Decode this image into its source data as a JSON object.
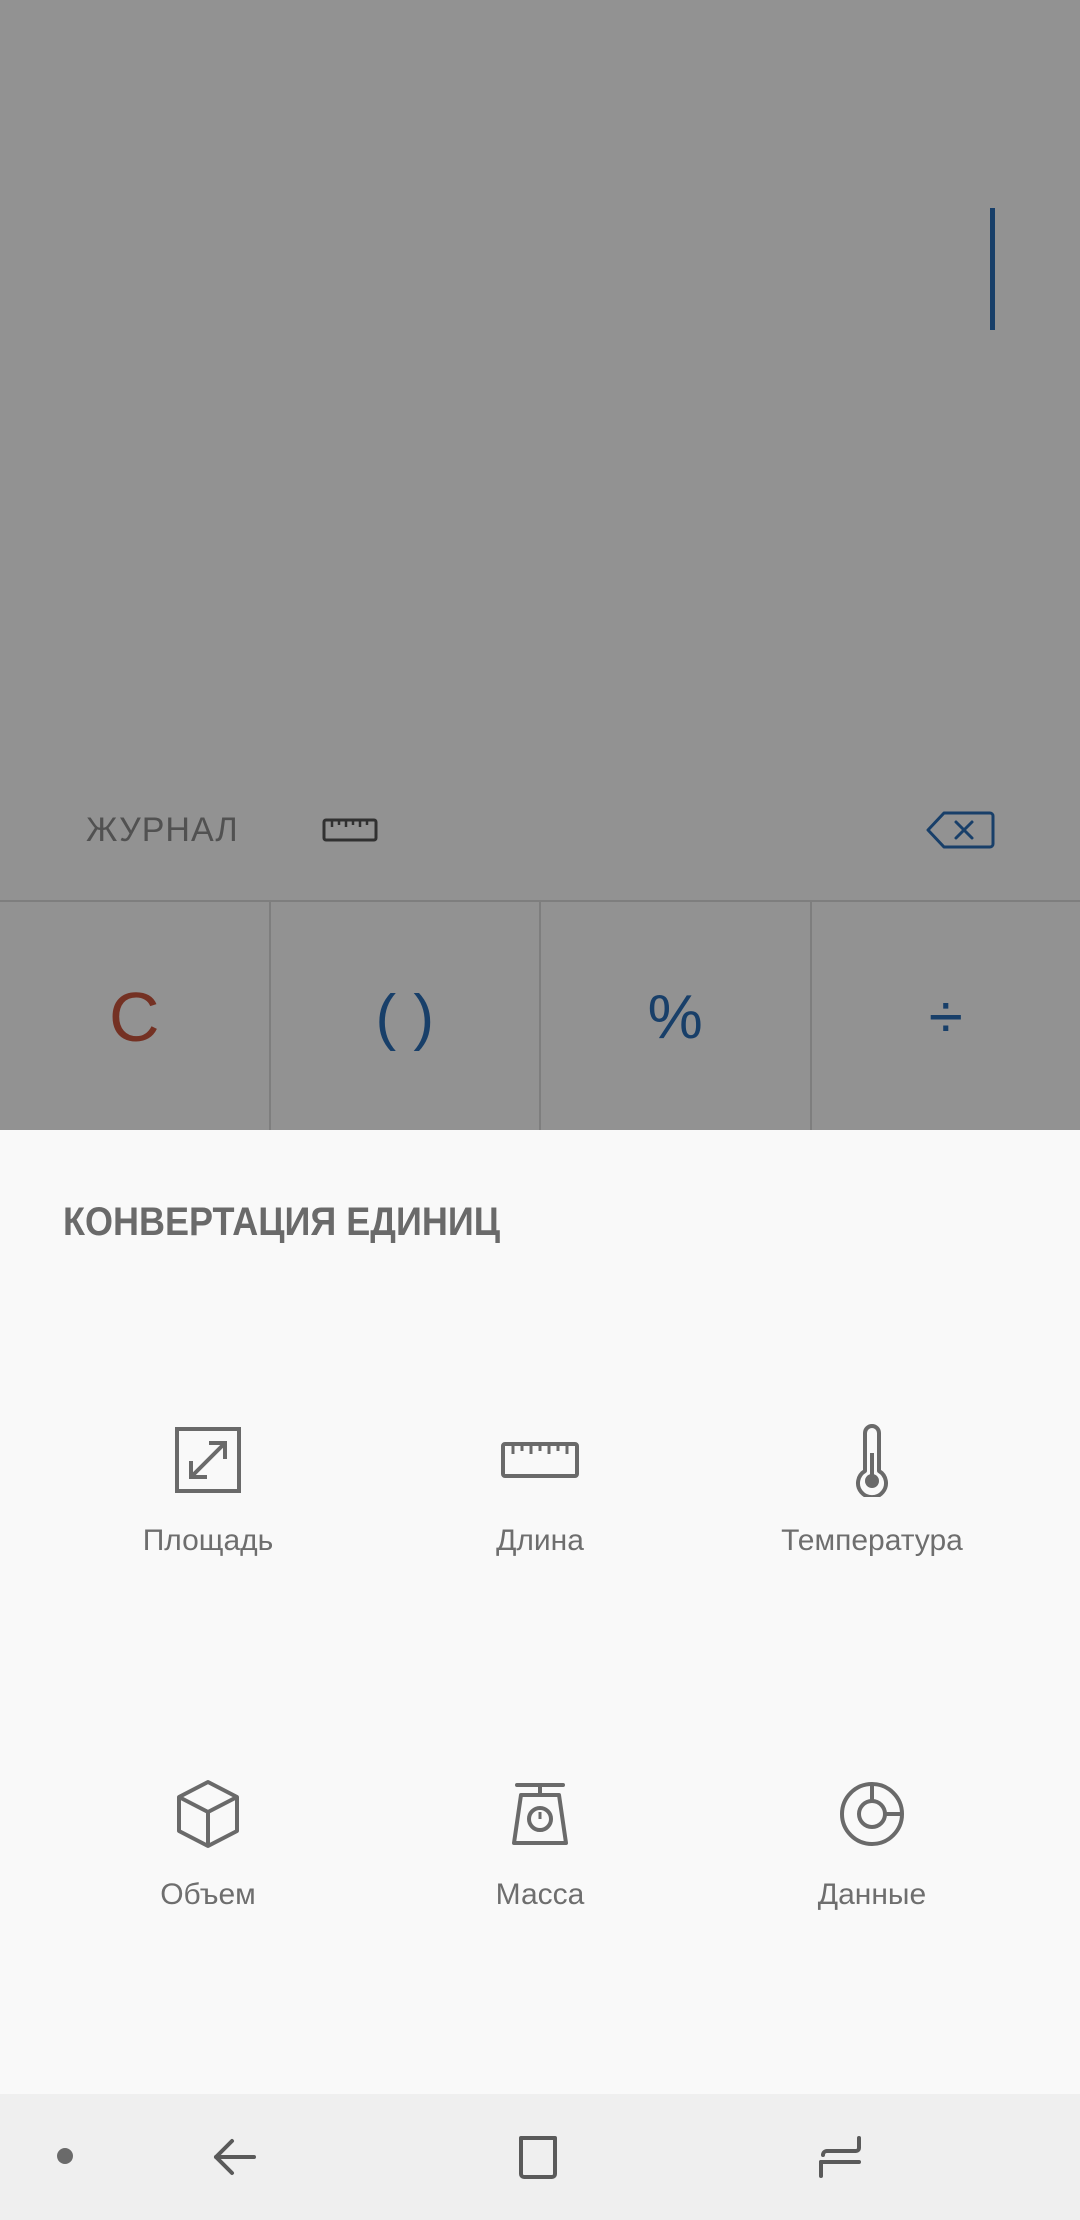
{
  "calculator": {
    "toolbar": {
      "history_label": "ЖУРНАЛ",
      "unit_converter_icon": "ruler-icon",
      "backspace_icon": "backspace-icon"
    },
    "keys": [
      {
        "label": "C",
        "color": "#c9553d"
      },
      {
        "label": "( )",
        "color": "#2a6db5"
      },
      {
        "label": "%",
        "color": "#2a6db5"
      },
      {
        "label": "÷",
        "color": "#2a6db5"
      }
    ],
    "cursor_color": "#2a6db5"
  },
  "sheet": {
    "title": "КОНВЕРТАЦИЯ ЕДИНИЦ",
    "units": [
      {
        "label": "Площадь",
        "icon": "area-icon"
      },
      {
        "label": "Длина",
        "icon": "ruler-icon"
      },
      {
        "label": "Температура",
        "icon": "thermometer-icon"
      },
      {
        "label": "Объем",
        "icon": "cube-icon"
      },
      {
        "label": "Масса",
        "icon": "scale-icon"
      },
      {
        "label": "Данные",
        "icon": "data-disk-icon"
      }
    ]
  },
  "navbar": {
    "buttons": [
      "dot-indicator",
      "back-icon",
      "home-icon",
      "recents-icon"
    ]
  },
  "colors": {
    "accent": "#2a6db5",
    "clear": "#c9553d",
    "icon": "#6a6a6a",
    "sheet_bg": "#f9f9f9",
    "navbar_bg": "#efefef"
  }
}
